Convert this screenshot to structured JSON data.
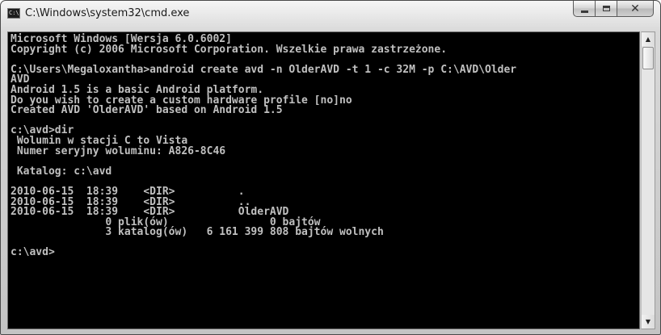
{
  "window": {
    "title": "C:\\Windows\\system32\\cmd.exe",
    "icon": "cmd-icon",
    "icon_label": "C:\\"
  },
  "caption_buttons": {
    "minimize_icon": "minimize-icon",
    "maximize_icon": "maximize-icon",
    "close_icon": "close-icon",
    "close_glyph": "✕"
  },
  "console": {
    "lines": [
      "Microsoft Windows [Wersja 6.0.6002]",
      "Copyright (c) 2006 Microsoft Corporation. Wszelkie prawa zastrzeżone.",
      "",
      "C:\\Users\\Megaloxantha>android create avd -n OlderAVD -t 1 -c 32M -p C:\\AVD\\Older",
      "AVD",
      "Android 1.5 is a basic Android platform.",
      "Do you wish to create a custom hardware profile [no]no",
      "Created AVD 'OlderAVD' based on Android 1.5",
      "",
      "c:\\avd>dir",
      " Wolumin w stacji C to Vista",
      " Numer seryjny woluminu: A826-8C46",
      "",
      " Katalog: c:\\avd",
      "",
      "2010-06-15  18:39    <DIR>          .",
      "2010-06-15  18:39    <DIR>          ..",
      "2010-06-15  18:39    <DIR>          OlderAVD",
      "               0 plik(ów)                0 bajtów",
      "               3 katalog(ów)   6 161 399 808 bajtów wolnych",
      "",
      "c:\\avd>"
    ]
  },
  "scrollbar": {
    "up_icon": "scroll-up-arrow-icon",
    "down_icon": "scroll-down-arrow-icon",
    "up_glyph": "▲",
    "down_glyph": "▼"
  }
}
